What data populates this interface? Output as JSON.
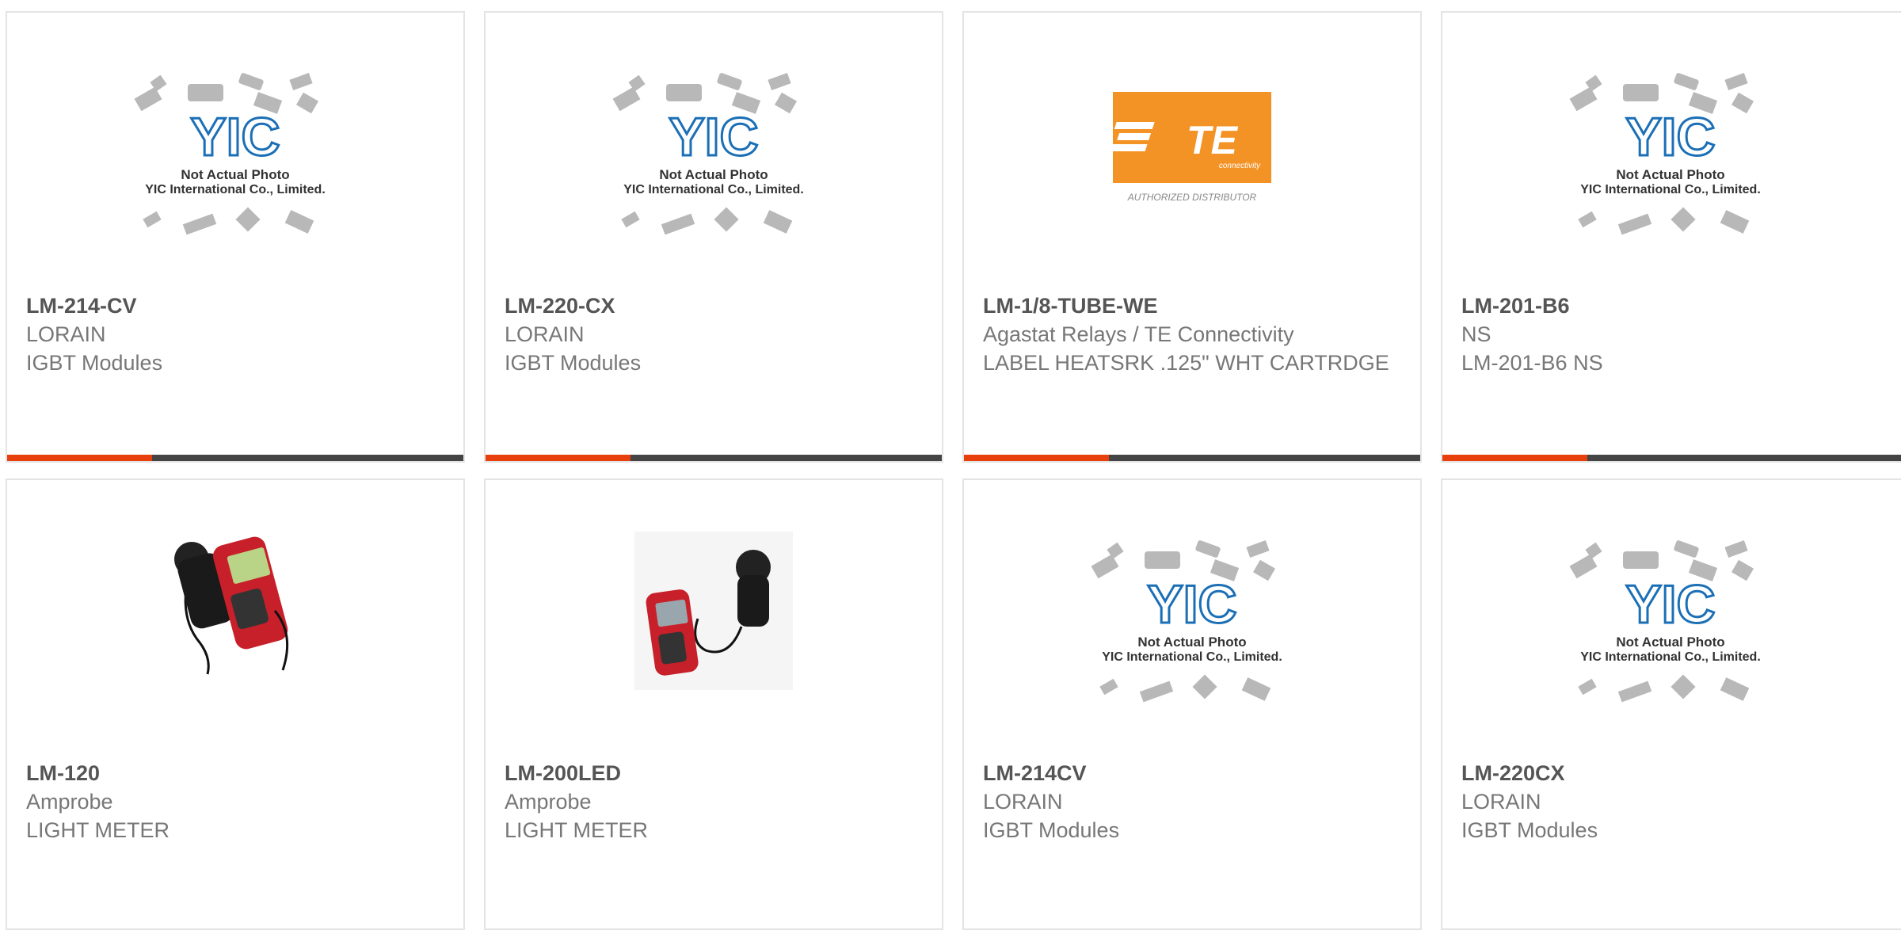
{
  "colors": {
    "accent": "#e8400c",
    "bar": "#444444",
    "border": "#e4e4e4"
  },
  "placeholder": {
    "line1": "Not Actual Photo",
    "line2": "YIC International Co., Limited.",
    "logo": "YIC"
  },
  "te_logo": {
    "text": "TE",
    "sub": "connectivity",
    "caption": "AUTHORIZED DISTRIBUTOR"
  },
  "products": [
    {
      "part": "LM-214-CV",
      "mfr": "LORAIN",
      "desc": "IGBT Modules",
      "image": "yic-placeholder"
    },
    {
      "part": "LM-220-CX",
      "mfr": "LORAIN",
      "desc": "IGBT Modules",
      "image": "yic-placeholder"
    },
    {
      "part": "LM-1/8-TUBE-WE",
      "mfr": "Agastat Relays / TE Connectivity",
      "desc": "LABEL HEATSRK .125\" WHT CARTRDGE",
      "image": "te-logo"
    },
    {
      "part": "LM-201-B6",
      "mfr": "NS",
      "desc": "LM-201-B6 NS",
      "image": "yic-placeholder"
    },
    {
      "part": "LM-120",
      "mfr": "Amprobe",
      "desc": "LIGHT METER",
      "image": "light-meter"
    },
    {
      "part": "LM-200LED",
      "mfr": "Amprobe",
      "desc": "LIGHT METER",
      "image": "light-meter"
    },
    {
      "part": "LM-214CV",
      "mfr": "LORAIN",
      "desc": "IGBT Modules",
      "image": "yic-placeholder"
    },
    {
      "part": "LM-220CX",
      "mfr": "LORAIN",
      "desc": "IGBT Modules",
      "image": "yic-placeholder"
    }
  ]
}
